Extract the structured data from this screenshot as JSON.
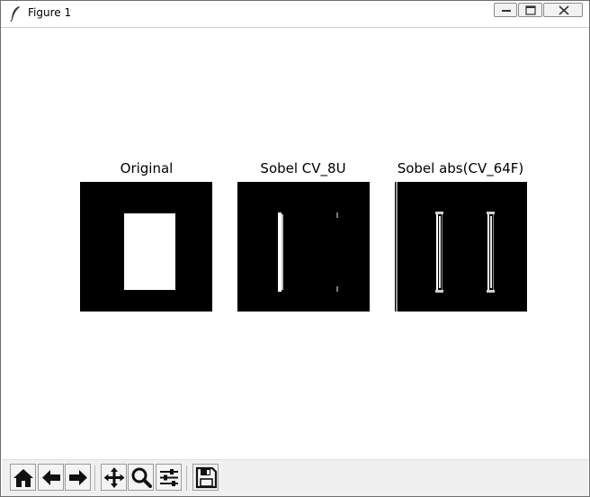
{
  "window": {
    "title": "Figure 1",
    "controls": [
      "minimize-icon",
      "maximize-icon",
      "close-icon"
    ]
  },
  "figure": {
    "panels": [
      {
        "title": "Original",
        "image": "white-rectangle-on-black"
      },
      {
        "title": "Sobel CV_8U",
        "image": "left-edge-only"
      },
      {
        "title": "Sobel abs(CV_64F)",
        "image": "both-vertical-edges"
      }
    ]
  },
  "toolbar": {
    "buttons": [
      {
        "name": "home",
        "icon": "home-icon"
      },
      {
        "name": "back",
        "icon": "arrow-left-icon"
      },
      {
        "name": "forward",
        "icon": "arrow-right-icon"
      },
      {
        "name": "pan",
        "icon": "move-icon"
      },
      {
        "name": "zoom",
        "icon": "magnifier-icon"
      },
      {
        "name": "configure-subplots",
        "icon": "sliders-icon"
      },
      {
        "name": "save",
        "icon": "floppy-disk-icon"
      }
    ]
  },
  "colors": {
    "image_background": "#000000",
    "image_foreground": "#ffffff",
    "toolbar_background": "#f0f0f0"
  }
}
